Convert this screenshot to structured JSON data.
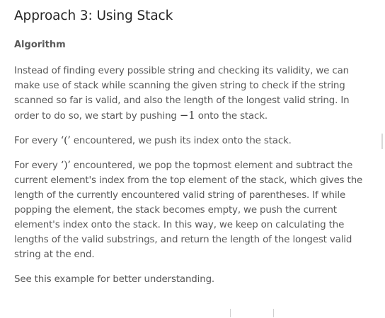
{
  "article": {
    "title": "Approach 3: Using Stack",
    "subtitle": "Algorithm",
    "p1": {
      "text": "Instead of finding every possible string and checking its validity, we can make use of stack while scanning the given string to check if the string scanned so far is valid, and also the length of the longest valid string. In order to do so, we start by pushing ",
      "math": "−1",
      "tail": " onto the stack."
    },
    "p2": {
      "pre": "For every ",
      "symbol": "‘(’",
      "post": " encountered, we push its index onto the stack."
    },
    "p3": {
      "pre": "For every ",
      "symbol": "‘)’",
      "post": " encountered, we pop the topmost element and subtract the current element's index from the top element of the stack, which gives the length of the currently encountered valid string of parentheses. If while popping the element, the stack becomes empty, we push the current element's index onto the stack. In this way, we keep on calculating the lengths of the valid substrings, and return the length of the longest valid string at the end."
    },
    "p4": {
      "text": "See this example for better understanding."
    }
  }
}
